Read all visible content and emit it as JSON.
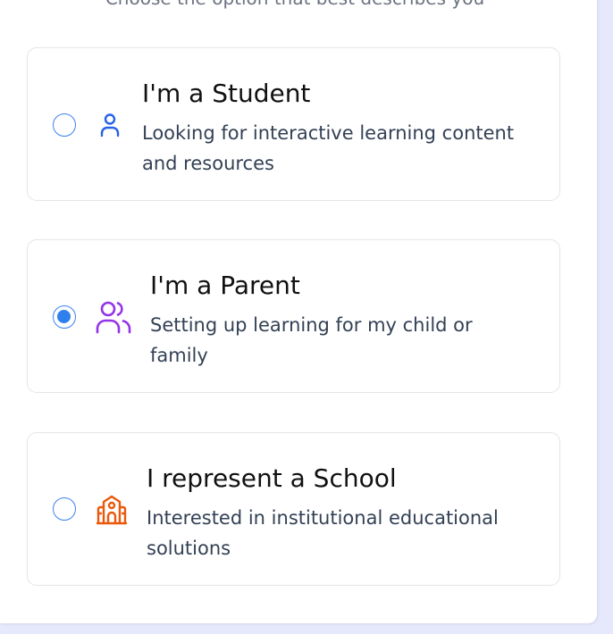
{
  "subtitle": "Choose the option that best describes you",
  "options": [
    {
      "title": "I'm a Student",
      "description": "Looking for interactive learning content and resources",
      "icon": "user-icon",
      "icon_color": "#2563eb",
      "selected": false
    },
    {
      "title": "I'm a Parent",
      "description": "Setting up learning for my child or family",
      "icon": "users-icon",
      "icon_color": "#9333ea",
      "selected": true
    },
    {
      "title": "I represent a School",
      "description": "Interested in institutional educational solutions",
      "icon": "school-icon",
      "icon_color": "#ea580c",
      "selected": false
    }
  ],
  "colors": {
    "radio_accent": "#2f80ed",
    "page_background": "#e5e9fb"
  }
}
